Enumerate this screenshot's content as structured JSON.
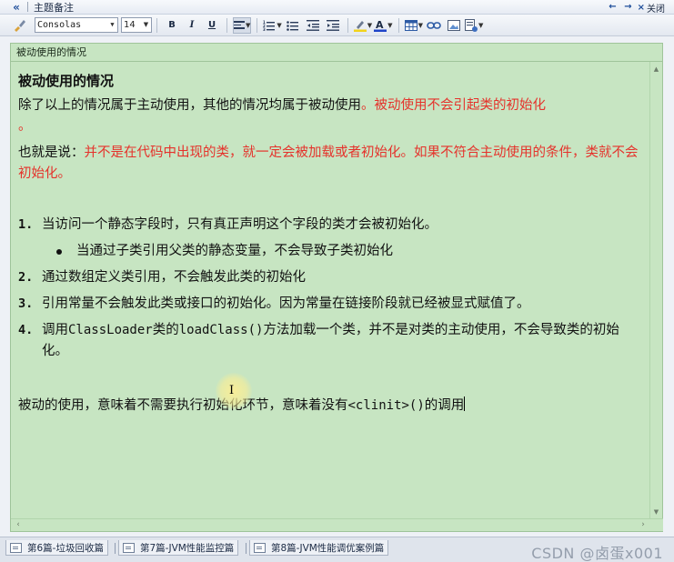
{
  "titlebar": {
    "collapse_icon": "double-left-chevron-icon",
    "title": "主题备注",
    "nav_prev": "←",
    "nav_next": "→",
    "close_label": "关闭"
  },
  "toolbar": {
    "font_name": "Consolas",
    "font_size": "14",
    "bold": "B",
    "italic": "I",
    "underline": "U"
  },
  "note": {
    "header": "被动使用的情况",
    "heading": "被动使用的情况",
    "para1_plain": "除了以上的情况属于主动使用，其他的情况均属于被动使用",
    "para1_red": "。被动使用不会引起类的初始化",
    "para1_red2": "。",
    "para2_plain": "也就是说：",
    "para2_red": "并不是在代码中出现的类，就一定会被加载或者初始化。如果不符合主动使用的条件，类就不会初始化。",
    "items": [
      {
        "num": "1.",
        "text": "当访问一个静态字段时，只有真正声明这个字段的类才会被初始化。"
      },
      {
        "num": "2.",
        "text": "通过数组定义类引用，不会触发此类的初始化"
      },
      {
        "num": "3.",
        "text": "引用常量不会触发此类或接口的初始化。因为常量在链接阶段就已经被显式赋值了。"
      }
    ],
    "sub_item": "当通过子类引用父类的静态变量，不会导致子类初始化",
    "item4_num": "4.",
    "item4_a": "调用",
    "item4_code1": "ClassLoader",
    "item4_b": "类的",
    "item4_code2": "loadClass()",
    "item4_c": "方法加载一个类，并不是对类的主动使用，不会导致类的初始化。",
    "final_a": "被动的使用，意味着不需要执行初始化环节，意味着没有",
    "final_code": "<clinit>()",
    "final_b": "的调用"
  },
  "tabs": [
    {
      "label": "第6篇-垃圾回收篇"
    },
    {
      "label": "第7篇-JVM性能监控篇"
    },
    {
      "label": "第8篇-JVM性能调优案例篇"
    }
  ],
  "watermark": "CSDN @卤蛋x001",
  "colors": {
    "note_bg": "#c7e5c2",
    "accent_red": "#e5322b"
  }
}
